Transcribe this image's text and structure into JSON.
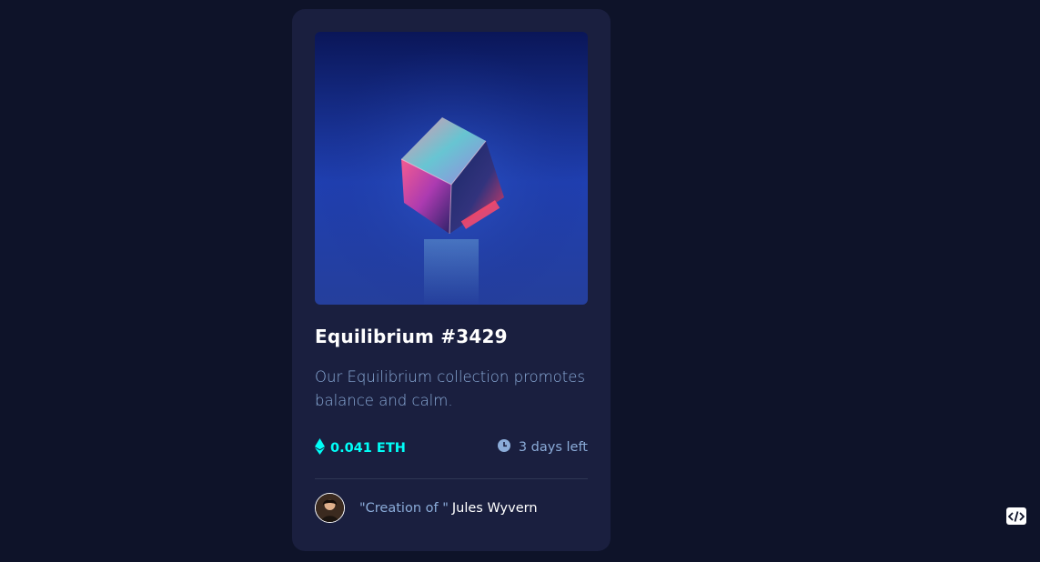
{
  "card": {
    "image_alt": "Equilibrium crystal cube",
    "title": "Equilibrium #3429",
    "description": "Our Equilibrium collection promotes balance and calm.",
    "price": {
      "value": "0.041 ETH",
      "icon": "ethereum-icon"
    },
    "time": {
      "value": "3 days left",
      "icon": "clock-icon"
    },
    "creator": {
      "prefix": "\"Creation of \"",
      "name": "Jules Wyvern",
      "avatar_icon": "avatar"
    }
  },
  "colors": {
    "page_bg": "#0e1329",
    "card_bg": "#1a1f3f",
    "accent_cyan": "#00fff8",
    "soft_blue": "#8bacd9",
    "white": "#ffffff",
    "divider": "#2e3654"
  },
  "widget": {
    "icon": "code-icon"
  }
}
